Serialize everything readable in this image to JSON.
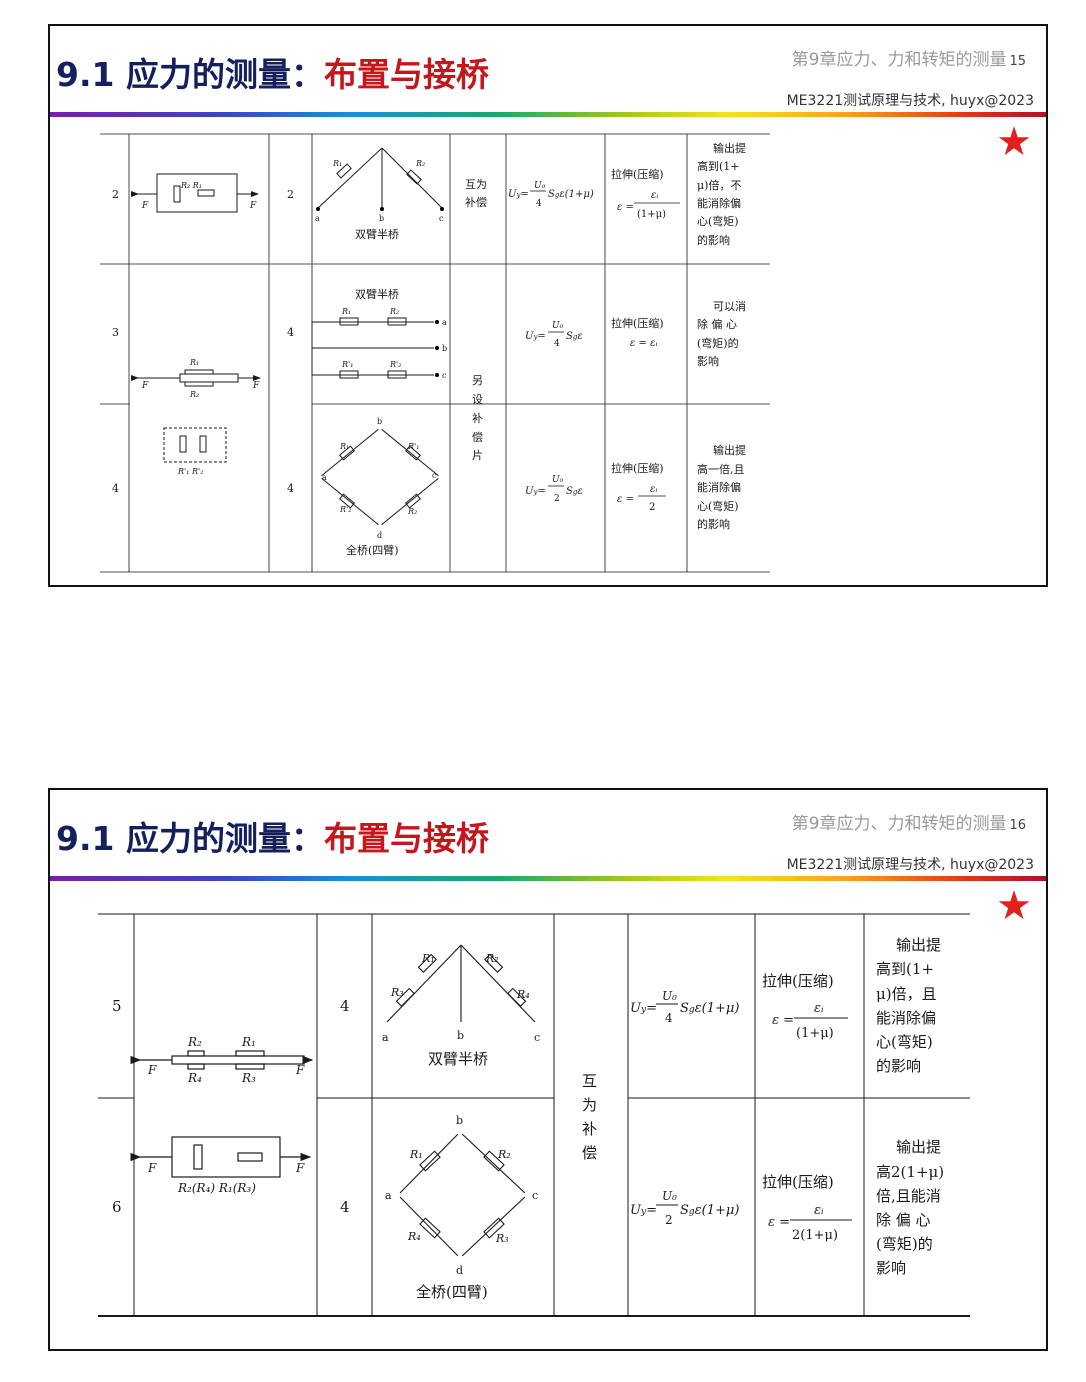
{
  "slide1": {
    "title_left": "9.1 应力的测量：",
    "title_right": "布置与接桥",
    "chapter": "第9章应力、力和转矩的测量",
    "page_num": "15",
    "course": "ME3221测试原理与技术, huyx@2023",
    "rows": [
      {
        "no": "2",
        "count": "2",
        "bridge_caption": "双臂半桥",
        "compensation": "互为补偿",
        "formula": "U_y = U_0/4 · S_g ε(1+μ)",
        "strain_state": "拉伸(压缩)",
        "strain_formula": "ε = ε_i/(1+μ)",
        "remark": "输出提高到(1+μ)倍，不能消除偏心(弯矩)的影响"
      },
      {
        "no": "3",
        "count": "4",
        "bridge_caption": "双臂半桥",
        "compensation": "另设补偿片",
        "formula": "U_y = U_0/4 · S_g ε",
        "strain_state": "拉伸(压缩)",
        "strain_formula": "ε = ε_i",
        "remark": "可以消除偏心(弯矩)的影响"
      },
      {
        "no": "4",
        "count": "4",
        "bridge_caption": "全桥(四臂)",
        "compensation": "另设补偿片",
        "formula": "U_y = U_0/2 · S_g ε",
        "strain_state": "拉伸(压缩)",
        "strain_formula": "ε = ε_i/2",
        "remark": "输出提高一倍,且能消除偏心(弯矩)的影响"
      }
    ]
  },
  "slide2": {
    "title_left": "9.1 应力的测量：",
    "title_right": "布置与接桥",
    "chapter": "第9章应力、力和转矩的测量",
    "page_num": "16",
    "course": "ME3221测试原理与技术, huyx@2023",
    "rows": [
      {
        "no": "5",
        "count": "4",
        "bridge_caption": "双臂半桥",
        "compensation": "互为补偿",
        "formula": "U_y = U_0/4 · S_g ε(1+μ)",
        "strain_state": "拉伸(压缩)",
        "strain_formula": "ε = ε_i/(1+μ)",
        "remark": "输出提高到(1+μ)倍，且能消除偏心(弯矩)的影响"
      },
      {
        "no": "6",
        "count": "4",
        "bridge_caption": "全桥(四臂)",
        "compensation": "互为补偿",
        "formula": "U_y = U_0/2 · S_g ε(1+μ)",
        "strain_state": "拉伸(压缩)",
        "strain_formula": "ε = ε_i/(2(1+μ))",
        "remark": "输出提高2(1+μ)倍,且能消除偏心(弯矩)的影响"
      }
    ]
  },
  "accent_colors": {
    "title_navy": "#14205e",
    "title_red": "#c4161c",
    "star": "#e3211c"
  },
  "icons": [
    "star-icon",
    "strain-gauge-resistor-icon"
  ]
}
